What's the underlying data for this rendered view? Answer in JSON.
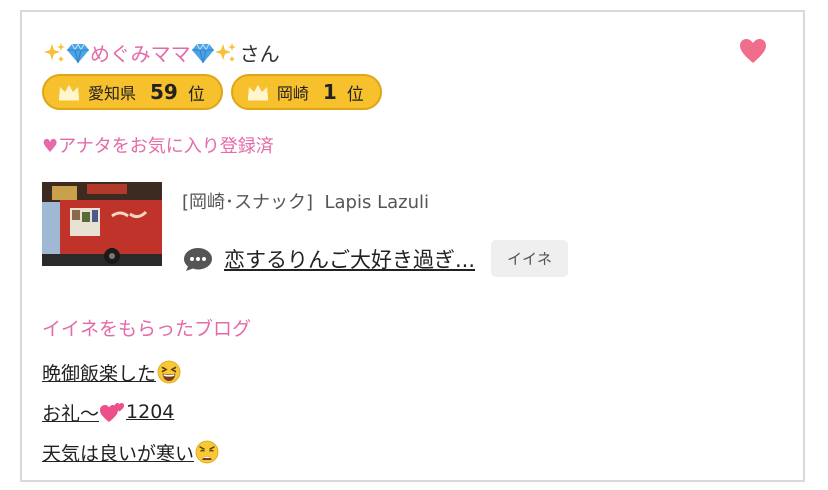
{
  "user": {
    "name": "めぐみママ",
    "suffix": "さん"
  },
  "badges": [
    {
      "area": "愛知県",
      "rank": "59",
      "unit": "位"
    },
    {
      "area": "岡崎",
      "rank": "1",
      "unit": "位"
    }
  ],
  "favorite_label": "♥アナタをお気に入り登録済",
  "shop": {
    "category": "[岡崎･スナック]",
    "name": "Lapis Lazuli"
  },
  "comment": {
    "text": "恋するりんご大好き過ぎ...",
    "button": "イイネ"
  },
  "blog": {
    "heading": "イイネをもらったブログ",
    "items": [
      {
        "text": "晩御飯楽した",
        "emoji": "grinning-squint-face"
      },
      {
        "text": "お礼～",
        "emoji": "two-hearts",
        "suffix": " 1204"
      },
      {
        "text": "天気は良いが寒い",
        "emoji": "weary-face"
      }
    ]
  },
  "colors": {
    "pink": "#e46aa9",
    "gold": "#f7c02d",
    "heart": "#f06d8c"
  }
}
